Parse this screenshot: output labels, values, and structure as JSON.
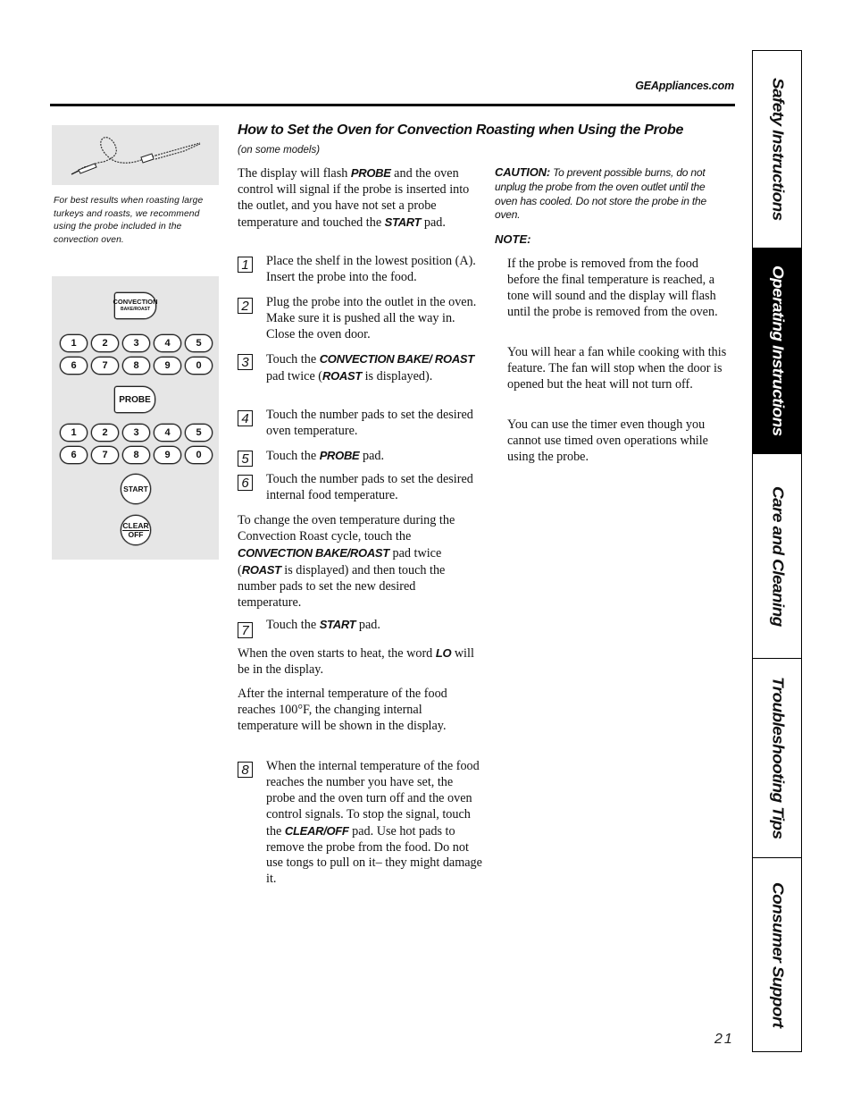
{
  "header": {
    "site_url": "GEAppliances.com"
  },
  "sidebar_figure": {
    "illustration": "meat-probe-illustration",
    "caption": "For best results when roasting large turkeys and roasts, we recommend using the probe included in the convection oven."
  },
  "keypad": {
    "convection_pad": {
      "line1": "CONVECTION",
      "line2": "BAKE/ROAST"
    },
    "number_rows_1": [
      [
        "1",
        "2",
        "3",
        "4",
        "5"
      ],
      [
        "6",
        "7",
        "8",
        "9",
        "0"
      ]
    ],
    "probe_pad": "PROBE",
    "number_rows_2": [
      [
        "1",
        "2",
        "3",
        "4",
        "5"
      ],
      [
        "6",
        "7",
        "8",
        "9",
        "0"
      ]
    ],
    "start_pad": "START",
    "clear_pad": {
      "line1": "CLEAR",
      "line2": "OFF"
    }
  },
  "main": {
    "heading": "How to Set the Oven for Convection Roasting when Using the Probe",
    "subheading": "(on some models)",
    "intro": {
      "t1": "The display will flash ",
      "k1": "PROBE",
      "t2": " and the oven control will signal if the probe is inserted into the outlet, and you have not set a probe temperature and touched the ",
      "k2": "START",
      "t3": " pad."
    },
    "steps": [
      {
        "num": "1",
        "text": "Place the shelf in the lowest position (A). Insert the probe into the food."
      },
      {
        "num": "2",
        "text": "Plug the probe into the outlet in the oven. Make sure it is pushed all the way in. Close the oven door."
      },
      {
        "num": "3",
        "t1": "Touch the ",
        "k1": "CONVECTION BAKE/ ROAST",
        "t2": " pad twice (",
        "k2": "ROAST",
        "t3": " is displayed)."
      },
      {
        "num": "4",
        "text": "Touch the number pads to set the desired oven temperature."
      },
      {
        "num": "5",
        "t1": "Touch the ",
        "k1": "PROBE",
        "t2": " pad."
      },
      {
        "num": "6",
        "text": "Touch the number pads to set the desired internal food temperature."
      },
      {
        "num": "7",
        "t1": "Touch the ",
        "k1": "START",
        "t2": " pad."
      },
      {
        "num": "8",
        "t1": "When the internal temperature of the food reaches the number you have set, the probe and the oven turn off and the oven control signals. To stop the signal, touch the ",
        "k1": "CLEAR/OFF",
        "t2": " pad. Use hot pads to remove the probe from the food. Do not use tongs to pull on it– they might damage it."
      }
    ],
    "change_temp": {
      "t1": "To change the oven temperature during the Convection Roast cycle, touch the ",
      "k1": "CONVECTION BAKE/ROAST",
      "t2": " pad twice (",
      "k2": "ROAST",
      "t3": " is displayed) and then touch the number pads to set the new desired temperature."
    },
    "lo_para": {
      "t1": "When the oven starts to heat, the word ",
      "k1": "LO",
      "t2": " will be in the display."
    },
    "after_para": "After the internal temperature of the food reaches 100°F, the changing internal temperature will be shown in the display."
  },
  "notes": {
    "caution_label": "CAUTION:",
    "caution_text": " To prevent possible burns, do not unplug the probe from the oven outlet until the oven has cooled. Do not store the probe in the oven.",
    "note_label": "NOTE:",
    "paragraphs": [
      "If the probe is removed from the food before the final temperature is reached, a tone will sound and the display will flash until the probe is removed from the oven.",
      "You will hear a fan while cooking with this feature. The fan will stop when the door is opened but the heat will not turn off.",
      "You can use the timer even though you cannot use timed oven operations while using the probe."
    ]
  },
  "side_tabs": [
    {
      "label": "Safety Instructions",
      "active": false
    },
    {
      "label": "Operating Instructions",
      "active": true
    },
    {
      "label": "Care and Cleaning",
      "active": false
    },
    {
      "label": "Troubleshooting Tips",
      "active": false
    },
    {
      "label": "Consumer Support",
      "active": false
    }
  ],
  "footer": {
    "page_number": "21"
  }
}
